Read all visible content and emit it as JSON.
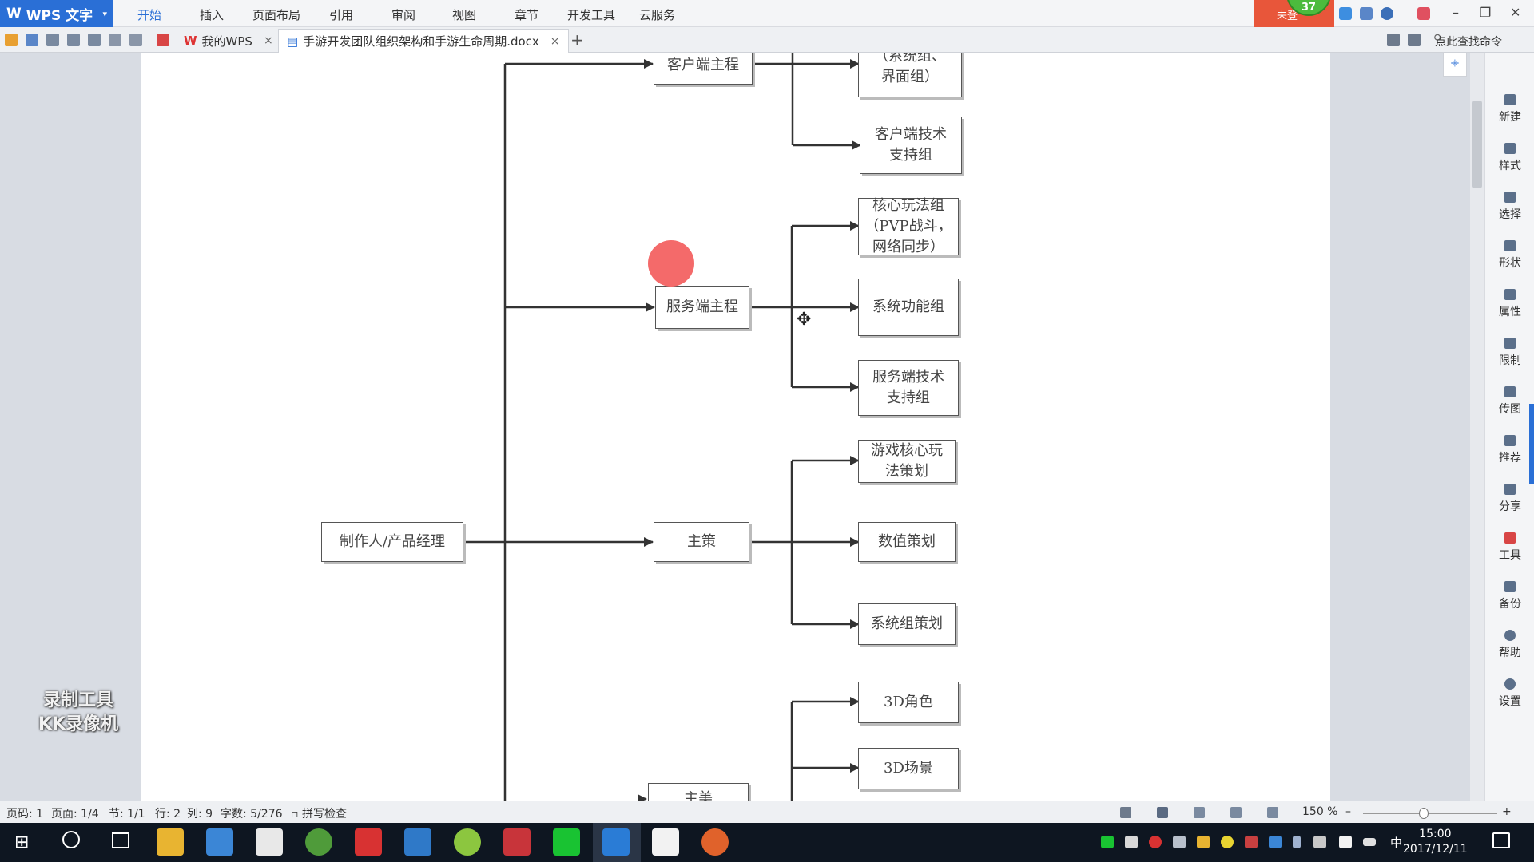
{
  "app": {
    "name": "WPS 文字",
    "logo": "W"
  },
  "menu": [
    "开始",
    "插入",
    "页面布局",
    "引用",
    "审阅",
    "视图",
    "章节",
    "开发工具",
    "云服务"
  ],
  "login_text": "未登",
  "level_badge": "37",
  "tabs": [
    {
      "label": "我的WPS",
      "close": "×"
    },
    {
      "label": "手游开发团队组织架构和手游生命周期.docx",
      "close": "×"
    }
  ],
  "new_tab": "+",
  "search_command": "点此查找命令",
  "window_controls": [
    "–",
    "❐",
    "✕"
  ],
  "right_sidebar": [
    "新建",
    "样式",
    "选择",
    "形状",
    "属性",
    "限制",
    "传图",
    "推荐",
    "分享",
    "工具",
    "备份",
    "帮助",
    "设置"
  ],
  "diagram": {
    "nodes": {
      "root": "制作人/产品经理",
      "client_lead": "客户端主程",
      "client_sys": "（系统组、\n界面组）",
      "client_tech": "客户端技术\n支持组",
      "core_play": "核心玩法组\n（PVP战斗，\n网络同步）",
      "server_lead": "服务端主程",
      "sys_func": "系统功能组",
      "server_tech": "服务端技术\n支持组",
      "game_core": "游戏核心玩\n法策划",
      "designer_lead": "主策",
      "numeric": "数值策划",
      "sys_design": "系统组策划",
      "role3d": "3D角色",
      "scene3d": "3D场景",
      "art_lead": "主美"
    }
  },
  "watermark": {
    "line1": "录制工具",
    "line2": "KK录像机"
  },
  "status": {
    "page_code": "页码: 1",
    "pages": "页面: 1/4",
    "section": "节: 1/1",
    "row": "行: 2",
    "col": "列: 9",
    "words": "字数: 5/276",
    "spellcheck": "拼写检查",
    "zoom": "150 %",
    "zoom_minus": "–",
    "zoom_plus": "+"
  },
  "zoom_level": 0.45,
  "taskbar": {
    "time": "15:00",
    "date": "2017/12/11",
    "ime": "中"
  },
  "colors": {
    "accent": "#2a6fd6",
    "login": "#e8563a",
    "record_dot": "#f46a6a"
  }
}
